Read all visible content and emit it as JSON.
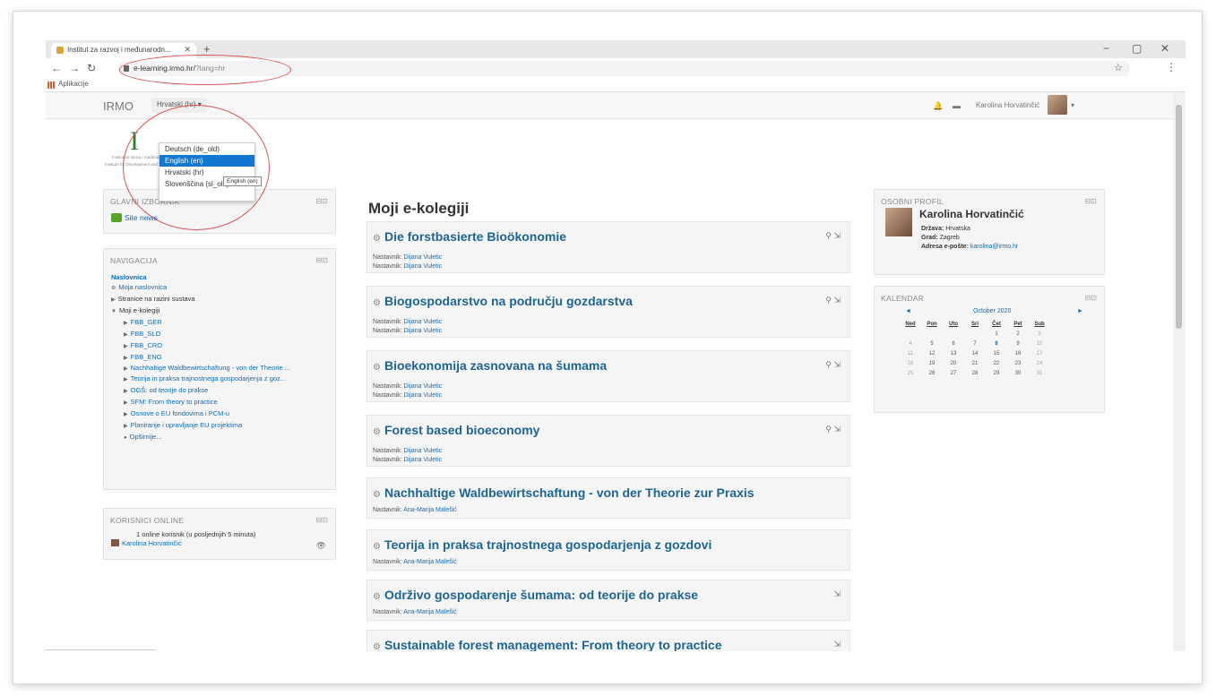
{
  "browser": {
    "tab_title": "Institut za razvoj i međunarodn...",
    "new_tab": "+",
    "url_host": "e-learning.irmo.hr/",
    "url_query": "?lang=hr",
    "bookmarks_label": "Aplikacije",
    "window_controls": [
      "−",
      "▢",
      "✕"
    ]
  },
  "navbar": {
    "brand": "IRMO",
    "language_button": "Hrvatski (hr) ▾",
    "user_name": "Karolina Horvatinčić"
  },
  "language_menu": {
    "items": [
      "Deutsch (de_old)",
      "English (en)",
      "Hrvatski (hr)",
      "Slovenščina (sl_old)"
    ],
    "tooltip": "English (en)"
  },
  "logo": {
    "letter": "I",
    "line1": "Institut za razvoj i međunarodne odnose",
    "line2": "Institute for Development and International Relations"
  },
  "main_menu_block": {
    "title": "GLAVNI IZBORNIK",
    "site_news": "Site news"
  },
  "navigation_block": {
    "title": "NAVIGACIJA",
    "home": "Naslovnica",
    "my_home": "Moja naslovnica",
    "site_pages": "Stranice na razini sustava",
    "my_courses": "Moji e-kolegiji",
    "courses": [
      "FBB_GER",
      "FBB_SLO",
      "FBB_CRO",
      "FBB_ENG",
      "Nachhaltige Waldbewirtschaftung - von der Theorie ...",
      "Teorija in praksa trajnostnega gospodarjenja z goz...",
      "OGŠ: od teorije do prakse",
      "SFM: From theory to practice",
      "Osnove o EU fondovima i PCM-u",
      "Planiranje i upravljanje EU projektima"
    ],
    "more": "Opširnije..."
  },
  "online_block": {
    "title": "KORISNICI ONLINE",
    "info": "1 online korisnik (u posljednjih 5 minuta)",
    "user": "Karolina Horvatinčić"
  },
  "main": {
    "heading": "Moji e-kolegiji",
    "teacher_label": "Nastavnik:",
    "courses": [
      {
        "title": "Die forstbasierte Bioökonomie",
        "teachers": [
          "Dijana Vuletic",
          "Dijana Vuletic"
        ]
      },
      {
        "title": "Biogospodarstvo na području gozdarstva",
        "teachers": [
          "Dijana Vuletic",
          "Dijana Vuletic"
        ]
      },
      {
        "title": "Bioekonomija zasnovana na šumama",
        "teachers": [
          "Dijana Vuletic",
          "Dijana Vuletic"
        ]
      },
      {
        "title": "Forest based bioeconomy",
        "teachers": [
          "Dijana Vuletic",
          "Dijana Vuletic"
        ]
      },
      {
        "title": "Nachhaltige Waldbewirtschaftung - von der Theorie zur Praxis",
        "teachers": [
          "Ana-Marija Malešić"
        ]
      },
      {
        "title": "Teorija in praksa trajnostnega gospodarjenja z gozdovi",
        "teachers": [
          "Ana-Marija Malešić"
        ]
      },
      {
        "title": "Održivo gospodarenje šumama: od teorije do prakse",
        "teachers": [
          "Ana-Marija Malešić"
        ]
      },
      {
        "title": "Sustainable forest management: From theory to practice",
        "teachers": []
      }
    ]
  },
  "profile_block": {
    "title": "OSOBNI PROFIL",
    "name": "Karolina Horvatinčić",
    "country_label": "Država:",
    "country": "Hrvatska",
    "city_label": "Grad:",
    "city": "Zagreb",
    "email_label": "Adresa e-pošte:",
    "email": "karolina@irmo.hr"
  },
  "calendar_block": {
    "title": "KALENDAR",
    "month": "October 2020",
    "prev": "◄",
    "next": "►",
    "weekdays": [
      "Ned",
      "Pon",
      "Uto",
      "Sri",
      "Čet",
      "Pet",
      "Sub"
    ],
    "weeks": [
      [
        "",
        "",
        "",
        "",
        "1",
        "2",
        "3"
      ],
      [
        "4",
        "5",
        "6",
        "7",
        "8",
        "9",
        "10"
      ],
      [
        "11",
        "12",
        "13",
        "14",
        "15",
        "16",
        "17"
      ],
      [
        "18",
        "19",
        "20",
        "21",
        "22",
        "23",
        "24"
      ],
      [
        "25",
        "26",
        "27",
        "28",
        "29",
        "30",
        "31"
      ]
    ],
    "today": "8"
  },
  "colors": {
    "accent": "#0f6cbf",
    "course_title": "#1d6594",
    "highlight": "#1177d1",
    "annotation": "#d9534f"
  }
}
